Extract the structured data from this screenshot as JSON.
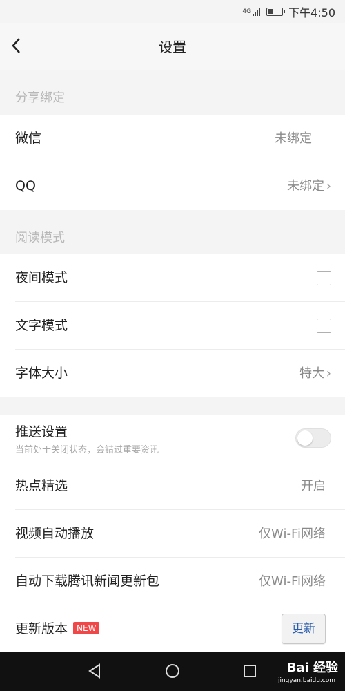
{
  "status_bar": {
    "network": "4G",
    "time": "下午4:50"
  },
  "nav": {
    "title": "设置"
  },
  "sections": {
    "share": {
      "header": "分享绑定",
      "items": [
        {
          "label": "微信",
          "value": "未绑定"
        },
        {
          "label": "QQ",
          "value": "未绑定"
        }
      ]
    },
    "reading": {
      "header": "阅读模式",
      "items": [
        {
          "label": "夜间模式"
        },
        {
          "label": "文字模式"
        },
        {
          "label": "字体大小",
          "value": "特大"
        }
      ]
    },
    "settings": {
      "push": {
        "label": "推送设置",
        "sub": "当前处于关闭状态，会错过重要资讯"
      },
      "hot": {
        "label": "热点精选",
        "value": "开启"
      },
      "video": {
        "label": "视频自动播放",
        "value": "仅Wi-Fi网络"
      },
      "download": {
        "label": "自动下载腾讯新闻更新包",
        "value": "仅Wi-Fi网络"
      },
      "update": {
        "label": "更新版本",
        "badge": "NEW",
        "button": "更新"
      }
    }
  },
  "icons": {
    "back": "chevron-left-icon",
    "chevron": "chevron-right-icon",
    "softkeys": [
      "back-triangle-icon",
      "home-circle-icon",
      "recent-square-icon"
    ]
  },
  "watermark": {
    "brand": "Bai 经验",
    "url": "jingyan.baidu.com"
  },
  "colors": {
    "badge": "#f04848",
    "update_text": "#2a5dae",
    "section_header": "#b8b8b8"
  }
}
